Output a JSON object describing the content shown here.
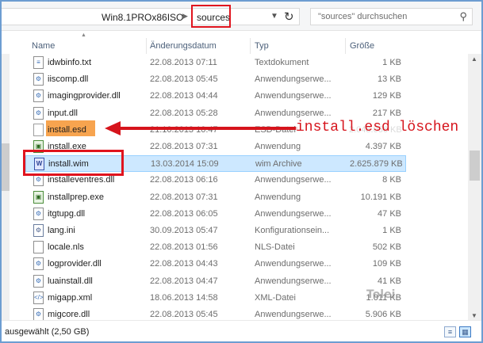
{
  "address": {
    "path_parent": "Win8.1PROx86ISO",
    "path_current": "sources",
    "search_placeholder": "\"sources\" durchsuchen"
  },
  "columns": {
    "name": "Name",
    "date": "Änderungsdatum",
    "type": "Typ",
    "size": "Größe"
  },
  "files": [
    {
      "name": "idwbinfo.txt",
      "date": "22.08.2013 07:11",
      "type": "Textdokument",
      "size": "1 KB",
      "icon": "text-file-icon"
    },
    {
      "name": "iiscomp.dll",
      "date": "22.08.2013 05:45",
      "type": "Anwendungserwe...",
      "size": "13 KB",
      "icon": "dll-file-icon"
    },
    {
      "name": "imagingprovider.dll",
      "date": "22.08.2013 04:44",
      "type": "Anwendungserwe...",
      "size": "129 KB",
      "icon": "dll-file-icon"
    },
    {
      "name": "input.dll",
      "date": "22.08.2013 05:28",
      "type": "Anwendungserwe...",
      "size": "217 KB",
      "icon": "dll-file-icon"
    },
    {
      "name": "install.esd",
      "date": "21.10.2013 10:47",
      "type": "ESD-Datei",
      "size": "2.048.056 KB",
      "icon": "esd-file-icon"
    },
    {
      "name": "install.exe",
      "date": "22.08.2013 07:31",
      "type": "Anwendung",
      "size": "4.397 KB",
      "icon": "exe-file-icon"
    },
    {
      "name": "install.wim",
      "date": "13.03.2014 15:09",
      "type": "wim Archive",
      "size": "2.625.879 KB",
      "icon": "wim-archive-icon"
    },
    {
      "name": "installeventres.dll",
      "date": "22.08.2013 06:16",
      "type": "Anwendungserwe...",
      "size": "8 KB",
      "icon": "dll-file-icon"
    },
    {
      "name": "installprep.exe",
      "date": "22.08.2013 07:31",
      "type": "Anwendung",
      "size": "10.191 KB",
      "icon": "exe-file-icon"
    },
    {
      "name": "itgtupg.dll",
      "date": "22.08.2013 06:05",
      "type": "Anwendungserwe...",
      "size": "47 KB",
      "icon": "dll-file-icon"
    },
    {
      "name": "lang.ini",
      "date": "30.09.2013 05:47",
      "type": "Konfigurationsein...",
      "size": "1 KB",
      "icon": "config-file-icon"
    },
    {
      "name": "locale.nls",
      "date": "22.08.2013 01:56",
      "type": "NLS-Datei",
      "size": "502 KB",
      "icon": "nls-file-icon"
    },
    {
      "name": "logprovider.dll",
      "date": "22.08.2013 04:43",
      "type": "Anwendungserwe...",
      "size": "109 KB",
      "icon": "dll-file-icon"
    },
    {
      "name": "luainstall.dll",
      "date": "22.08.2013 04:47",
      "type": "Anwendungserwe...",
      "size": "41 KB",
      "icon": "dll-file-icon"
    },
    {
      "name": "migapp.xml",
      "date": "18.06.2013 14:58",
      "type": "XML-Datei",
      "size": "1.011 KB",
      "icon": "xml-file-icon"
    },
    {
      "name": "migcore.dll",
      "date": "22.08.2013 05:45",
      "type": "Anwendungserwe...",
      "size": "5.906 KB",
      "icon": "dll-file-icon"
    }
  ],
  "annotation": {
    "text": "install.esd löschen",
    "color": "#d6141c"
  },
  "highlight_colors": {
    "esd": "#f7a44f",
    "wim": "#eff00e",
    "frame": "#e0141e",
    "selection": "#cde8ff"
  },
  "status": {
    "text": "ausgewählt (2,50 GB)"
  },
  "watermark": "Tolei"
}
